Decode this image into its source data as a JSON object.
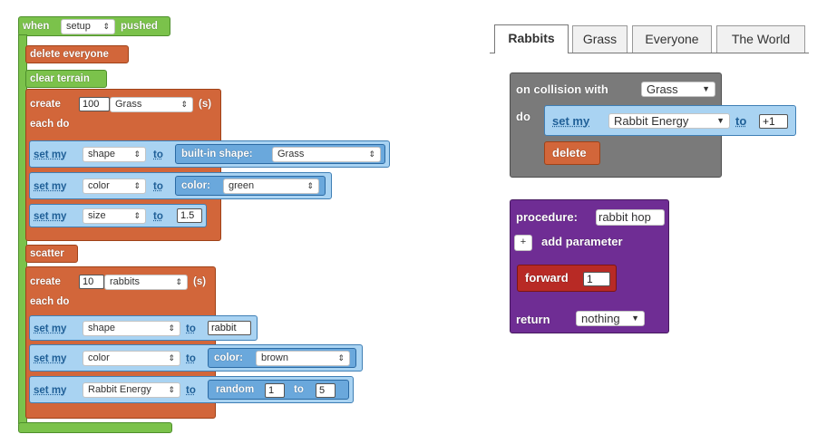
{
  "tabs": [
    {
      "label": "Rabbits"
    },
    {
      "label": "Grass"
    },
    {
      "label": "Everyone"
    },
    {
      "label": "The World"
    }
  ],
  "setup": {
    "when": "when",
    "event": "setup",
    "pushed": "pushed",
    "delete_everyone": "delete everyone",
    "clear_terrain": "clear terrain",
    "create1": {
      "label": "create",
      "count": "100",
      "breed": "Grass",
      "suffix": "(s)"
    },
    "each_do": "each do",
    "grass_sets": [
      {
        "label": "set my",
        "prop": "shape",
        "to": "to",
        "value_label": "built-in shape:",
        "value": "Grass"
      },
      {
        "label": "set my",
        "prop": "color",
        "to": "to",
        "value_label": "color:",
        "value": "green"
      },
      {
        "label": "set my",
        "prop": "size",
        "to": "to",
        "value": "1.5"
      }
    ],
    "scatter": "scatter",
    "create2": {
      "label": "create",
      "count": "10",
      "breed": "rabbits",
      "suffix": "(s)"
    },
    "each_do2": "each do",
    "rabbit_sets": [
      {
        "label": "set my",
        "prop": "shape",
        "to": "to",
        "value": "rabbit"
      },
      {
        "label": "set my",
        "prop": "color",
        "to": "to",
        "value_label": "color:",
        "value": "brown"
      },
      {
        "label": "set my",
        "prop": "Rabbit Energy",
        "to": "to",
        "random": "random",
        "from": "1",
        "to_word": "to",
        "upper": "5"
      }
    ]
  },
  "collision": {
    "label": "on collision with",
    "target": "Grass",
    "do": "do",
    "set_label": "set my",
    "prop": "Rabbit Energy",
    "to": "to",
    "value": "+1",
    "delete": "delete"
  },
  "procedure": {
    "label": "procedure:",
    "name": "rabbit hop",
    "plus": "+",
    "add_parameter": "add parameter",
    "forward": "forward",
    "forward_value": "1",
    "return": "return",
    "return_value": "nothing"
  },
  "colors": {
    "event_green": "#7bc24b",
    "action_orange": "#d2663a",
    "set_blue": "#a9d3f2",
    "collision_gray": "#7a7a7a",
    "procedure_purple": "#6f2d94",
    "motion_red": "#b82a25"
  }
}
